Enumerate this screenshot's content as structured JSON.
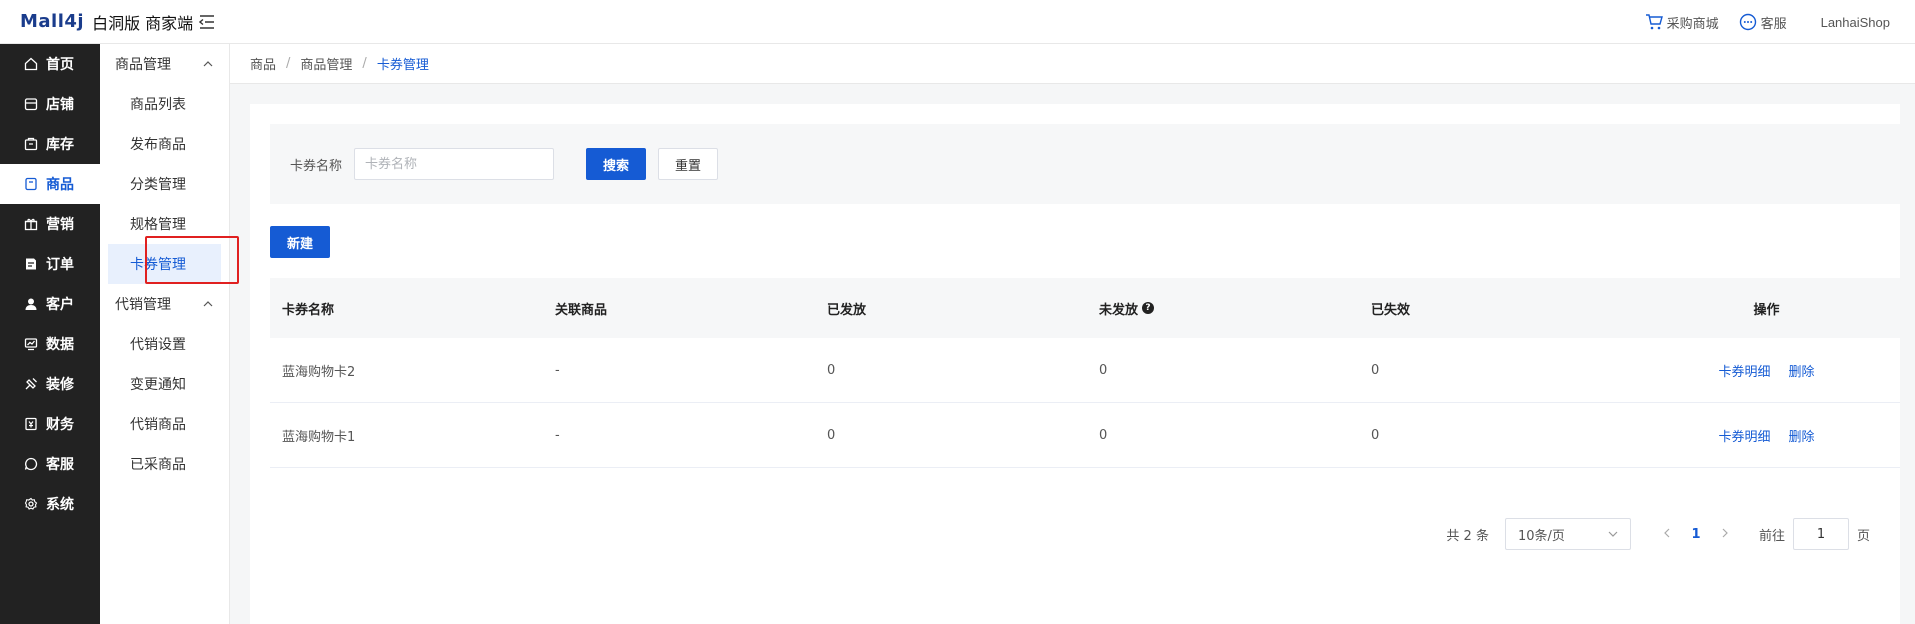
{
  "header": {
    "logo_prefix": "Mall4j",
    "logo_text": "白洞版 商家端",
    "procurement_label": "采购商城",
    "service_label": "客服",
    "user_name": "LanhaiShop"
  },
  "sidebar": {
    "items": [
      {
        "label": "首页",
        "icon": "home-icon"
      },
      {
        "label": "店铺",
        "icon": "store-icon"
      },
      {
        "label": "库存",
        "icon": "inventory-icon"
      },
      {
        "label": "商品",
        "icon": "product-icon"
      },
      {
        "label": "营销",
        "icon": "gift-icon"
      },
      {
        "label": "订单",
        "icon": "order-icon"
      },
      {
        "label": "客户",
        "icon": "customer-icon"
      },
      {
        "label": "数据",
        "icon": "data-icon"
      },
      {
        "label": "装修",
        "icon": "decorate-icon"
      },
      {
        "label": "财务",
        "icon": "finance-icon"
      },
      {
        "label": "客服",
        "icon": "service-icon"
      },
      {
        "label": "系统",
        "icon": "settings-icon"
      }
    ],
    "active_index": 3
  },
  "subnav": {
    "group1": "商品管理",
    "group1_items": [
      "商品列表",
      "发布商品",
      "分类管理",
      "规格管理",
      "卡券管理"
    ],
    "group2": "代销管理",
    "group2_items": [
      "代销设置",
      "变更通知",
      "代销商品",
      "已采商品"
    ]
  },
  "breadcrumb": {
    "items": [
      "商品",
      "商品管理"
    ],
    "current": "卡券管理",
    "separator": "/"
  },
  "search": {
    "label": "卡券名称",
    "placeholder": "卡券名称",
    "search_button": "搜索",
    "reset_button": "重置"
  },
  "new_button": "新建",
  "table": {
    "headers": [
      "卡券名称",
      "关联商品",
      "已发放",
      "未发放",
      "已失效",
      "操作"
    ],
    "rows": [
      {
        "name": "蓝海购物卡2",
        "product": "-",
        "issued": "0",
        "unissued": "0",
        "expired": "0"
      },
      {
        "name": "蓝海购物卡1",
        "product": "-",
        "issued": "0",
        "unissued": "0",
        "expired": "0"
      }
    ],
    "action_detail": "卡券明细",
    "action_delete": "删除"
  },
  "pagination": {
    "total": "共 2 条",
    "page_size": "10条/页",
    "current_page": "1",
    "jump_prefix": "前往",
    "jump_value": "1",
    "jump_suffix": "页"
  },
  "colors": {
    "primary": "#155bd4",
    "sidebar_bg": "#222222",
    "highlight": "#e02020"
  }
}
